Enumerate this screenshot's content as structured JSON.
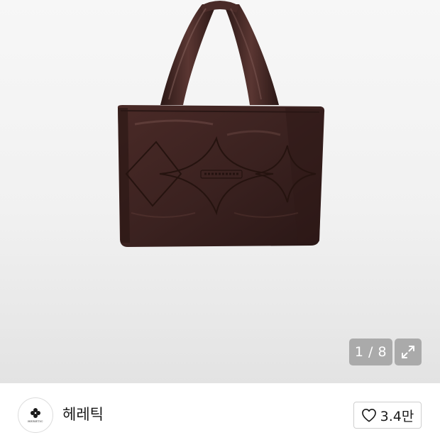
{
  "gallery": {
    "counter_text": "1 / 8",
    "image_subject": "brown quilted puffer tote bag",
    "product_color": "#3d2320"
  },
  "brand": {
    "name": "헤레틱",
    "logo_text": "HERETIC",
    "logo_icon": "clover-icon"
  },
  "like": {
    "count": "3.4만",
    "icon": "heart-outline-icon"
  }
}
